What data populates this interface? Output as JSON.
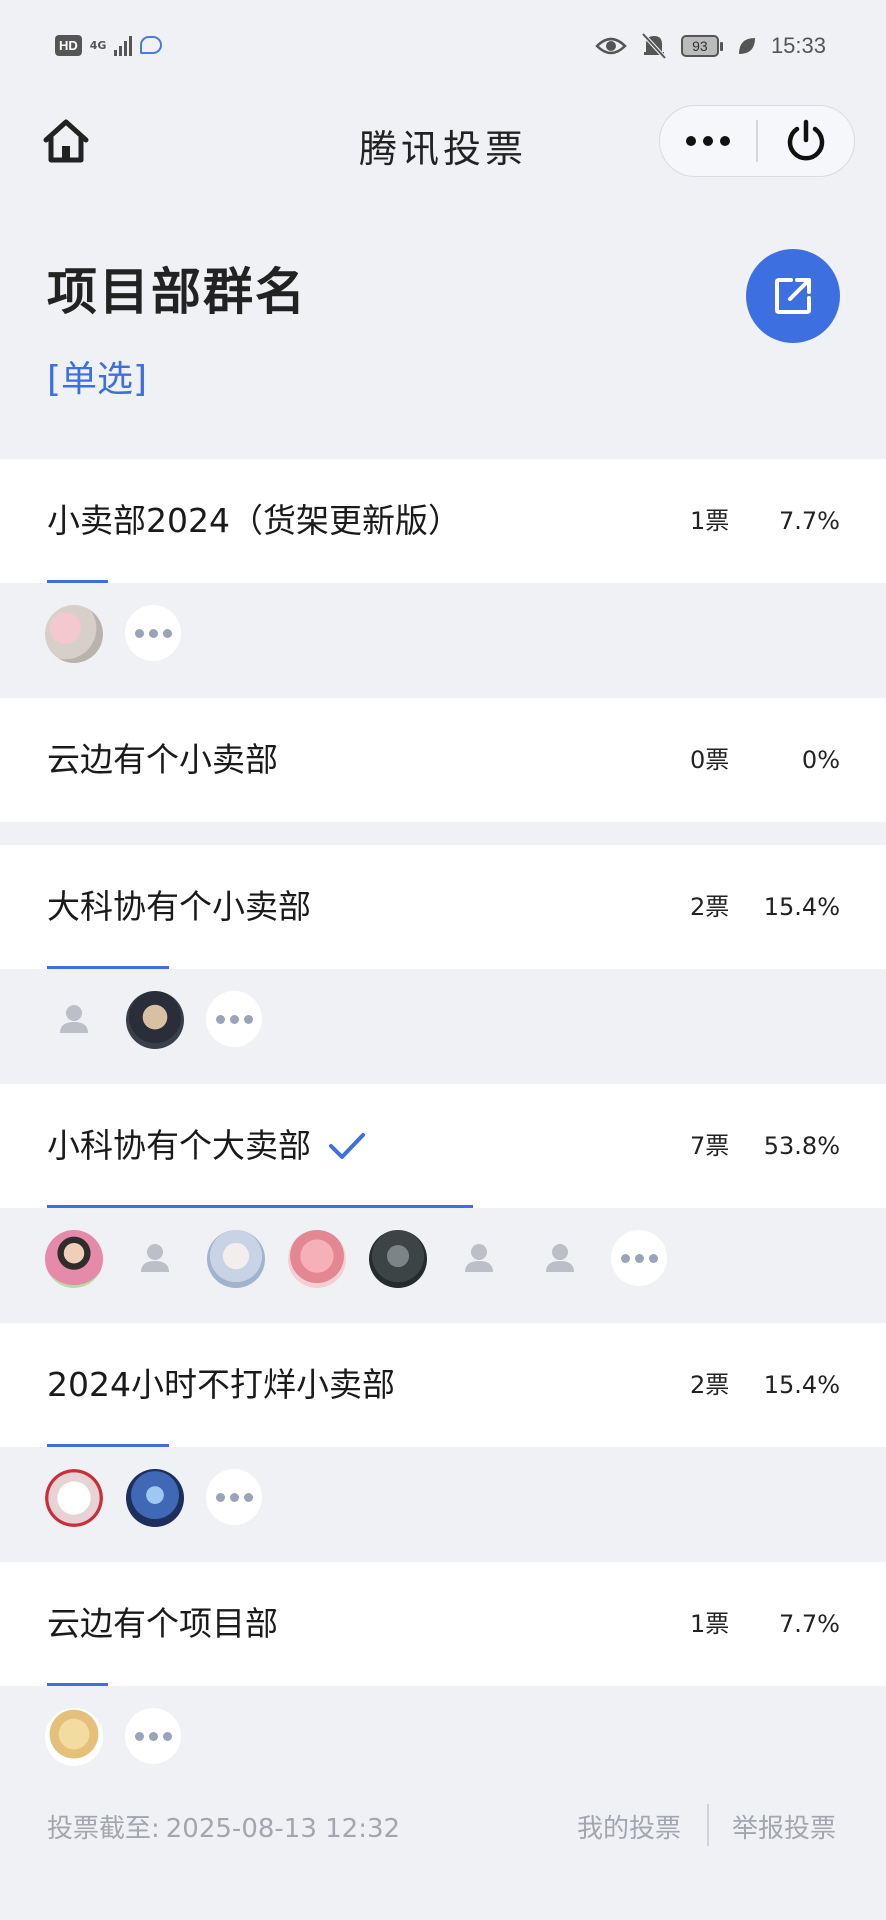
{
  "status_bar": {
    "hd": "HD",
    "network": "4G",
    "battery": "93",
    "time": "15:33"
  },
  "nav": {
    "title": "腾讯投票"
  },
  "header": {
    "title": "项目部群名",
    "vote_type": "[单选]"
  },
  "colors": {
    "accent": "#3d6fe0",
    "background": "#f0f1f5"
  },
  "options": [
    {
      "label": "小卖部2024（货架更新版）",
      "votes": "1票",
      "percent": "7.7%",
      "ratio": 0.077,
      "selected": false,
      "voters": [
        "avatar-flowers",
        "more"
      ]
    },
    {
      "label": "云边有个小卖部",
      "votes": "0票",
      "percent": "0%",
      "ratio": 0,
      "selected": false,
      "voters": []
    },
    {
      "label": "大科协有个小卖部",
      "votes": "2票",
      "percent": "15.4%",
      "ratio": 0.154,
      "selected": false,
      "voters": [
        "placeholder",
        "avatar-bear",
        "more"
      ]
    },
    {
      "label": "小科协有个大卖部",
      "votes": "7票",
      "percent": "53.8%",
      "ratio": 0.538,
      "selected": true,
      "voters": [
        "avatar-girl",
        "placeholder",
        "avatar-anime",
        "avatar-pink-bear",
        "avatar-dark",
        "placeholder",
        "placeholder",
        "more"
      ]
    },
    {
      "label": "2024小时不打烊小卖部",
      "votes": "2票",
      "percent": "15.4%",
      "ratio": 0.154,
      "selected": false,
      "voters": [
        "avatar-sketch",
        "avatar-blue-anime",
        "more"
      ]
    },
    {
      "label": "云边有个项目部",
      "votes": "1票",
      "percent": "7.7%",
      "ratio": 0.077,
      "selected": false,
      "voters": [
        "avatar-cartoon-bear",
        "more"
      ]
    }
  ],
  "footer": {
    "deadline_label": "投票截至:",
    "deadline_value": "2025-08-13 12:32",
    "my_votes": "我的投票",
    "report": "举报投票"
  }
}
